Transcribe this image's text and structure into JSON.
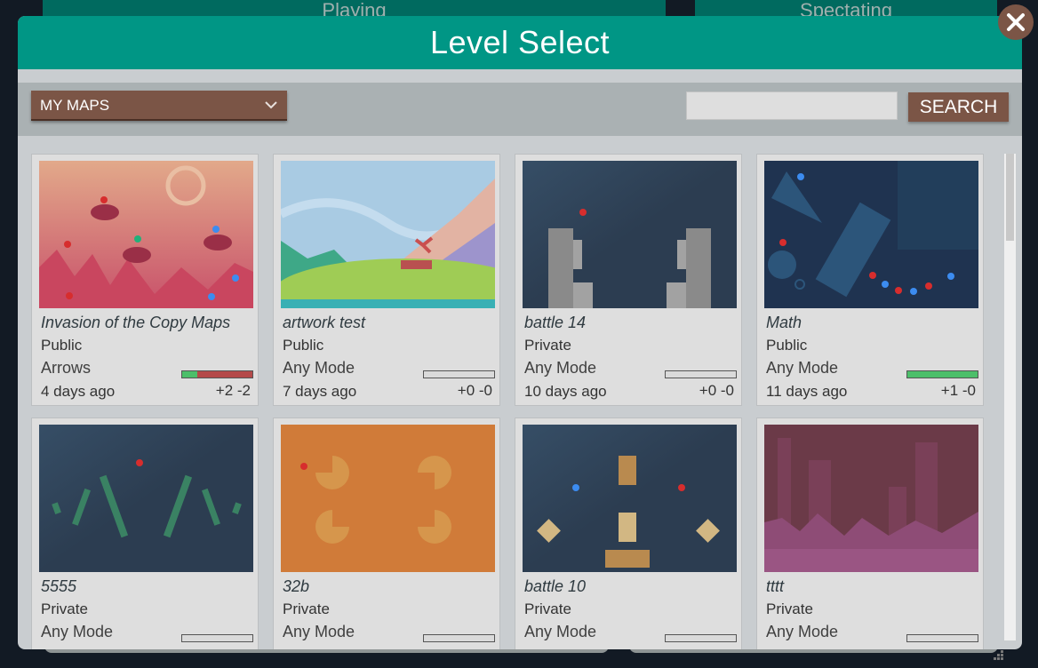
{
  "background_tabs": [
    "Playing",
    "Spectating"
  ],
  "modal": {
    "title": "Level Select",
    "close_icon": "close-x-icon"
  },
  "toolbar": {
    "filter": {
      "selected": "MY MAPS",
      "icon": "chevron-down-icon"
    },
    "search": {
      "value": "",
      "placeholder": ""
    },
    "search_label": "SEARCH"
  },
  "colors": {
    "header": "#009685",
    "button": "#7b5546",
    "upvote": "#4cbf6a",
    "downvote": "#b44a4a"
  },
  "maps": [
    {
      "name": "Invasion of the Copy Maps",
      "visibility": "Public",
      "mode": "Arrows",
      "date": "4 days ago",
      "votes": "+2 -2",
      "up": 2,
      "down": 2,
      "thumbnail": "pink-city-crabs"
    },
    {
      "name": "artwork test",
      "visibility": "Public",
      "mode": "Any Mode",
      "date": "7 days ago",
      "votes": "+0 -0",
      "up": 0,
      "down": 0,
      "thumbnail": "landscape-windmill"
    },
    {
      "name": "battle 14",
      "visibility": "Private",
      "mode": "Any Mode",
      "date": "10 days ago",
      "votes": "+0 -0",
      "up": 0,
      "down": 0,
      "thumbnail": "grey-towers"
    },
    {
      "name": "Math",
      "visibility": "Public",
      "mode": "Any Mode",
      "date": "11 days ago",
      "votes": "+1 -0",
      "up": 1,
      "down": 0,
      "thumbnail": "blue-geometry"
    },
    {
      "name": "5555",
      "visibility": "Private",
      "mode": "Any Mode",
      "date": "",
      "votes": "",
      "up": 0,
      "down": 0,
      "thumbnail": "green-sticks"
    },
    {
      "name": "32b",
      "visibility": "Private",
      "mode": "Any Mode",
      "date": "",
      "votes": "",
      "up": 0,
      "down": 0,
      "thumbnail": "orange-pacmen"
    },
    {
      "name": "battle 10",
      "visibility": "Private",
      "mode": "Any Mode",
      "date": "",
      "votes": "",
      "up": 0,
      "down": 0,
      "thumbnail": "tan-blocks"
    },
    {
      "name": "tttt",
      "visibility": "Private",
      "mode": "Any Mode",
      "date": "",
      "votes": "",
      "up": 0,
      "down": 0,
      "thumbnail": "purple-ruins"
    }
  ]
}
